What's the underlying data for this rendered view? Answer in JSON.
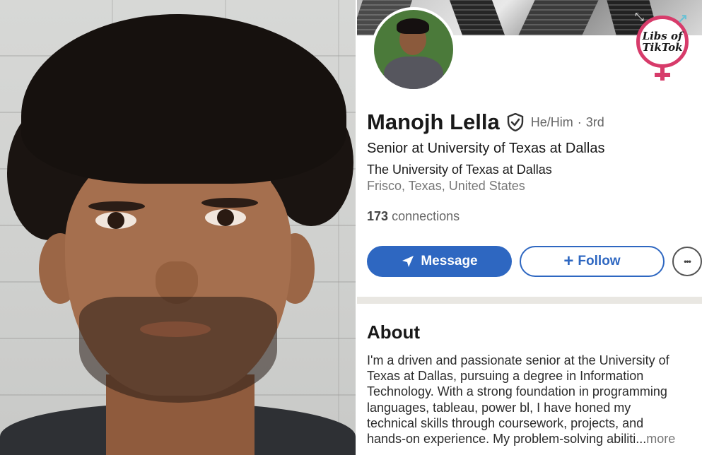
{
  "profile": {
    "name": "Manojh Lella",
    "pronouns": "He/Him",
    "separator": "·",
    "degree": "3rd",
    "headline": "Senior at University of Texas at Dallas",
    "school": "The University of Texas at Dallas",
    "location": "Frisco, Texas, United States",
    "connections_count": "173",
    "connections_label": "connections"
  },
  "actions": {
    "message_label": "Message",
    "follow_label": "Follow",
    "follow_prefix": "+",
    "more_label": "•••"
  },
  "about": {
    "title": "About",
    "lines": [
      "I'm a driven and passionate senior at the University of",
      "Texas at Dallas, pursuing a degree in Information",
      "Technology. With a strong foundation in programming",
      "languages, tableau, power bl, I have honed my",
      "technical skills through coursework, projects, and",
      "hands-on experience. My problem-solving abiliti..."
    ],
    "more_label": "more"
  },
  "watermark": {
    "line1": "Libs of",
    "line2": "TikTok"
  },
  "colors": {
    "accent_blue": "#2e67c1",
    "watermark_pink": "#d73b6a"
  },
  "icons": [
    "verified-shield-icon",
    "send-icon",
    "plus-icon",
    "more-icon",
    "expand-icon",
    "venus-symbol-icon"
  ]
}
